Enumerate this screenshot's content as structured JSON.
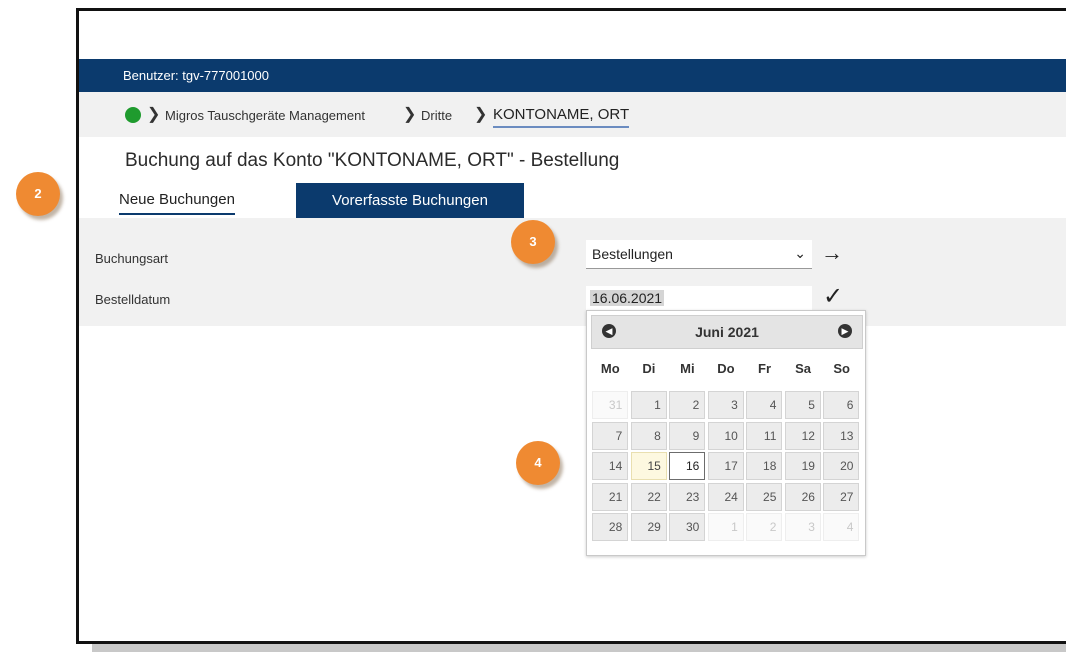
{
  "user_bar": {
    "label": "Benutzer: tgv-777001000"
  },
  "breadcrumb": {
    "items": [
      "Migros Tauschgeräte Management",
      "Dritte"
    ],
    "current": "KONTONAME, ORT"
  },
  "page_title": "Buchung auf das Konto \"KONTONAME, ORT\" - Bestellung",
  "tabs": {
    "new": "Neue Buchungen",
    "prepared": "Vorerfasste Buchungen"
  },
  "form": {
    "buchungsart_label": "Buchungsart",
    "buchungsart_value": "Bestellungen",
    "bestelldatum_label": "Bestelldatum",
    "bestelldatum_value": "16.06.2021"
  },
  "calendar": {
    "title": "Juni 2021",
    "weekdays": [
      "Mo",
      "Di",
      "Mi",
      "Do",
      "Fr",
      "Sa",
      "So"
    ],
    "weeks": [
      [
        "31",
        "1",
        "2",
        "3",
        "4",
        "5",
        "6"
      ],
      [
        "7",
        "8",
        "9",
        "10",
        "11",
        "12",
        "13"
      ],
      [
        "14",
        "15",
        "16",
        "17",
        "18",
        "19",
        "20"
      ],
      [
        "21",
        "22",
        "23",
        "24",
        "25",
        "26",
        "27"
      ],
      [
        "28",
        "29",
        "30",
        "1",
        "2",
        "3",
        "4"
      ]
    ],
    "today": "15",
    "selected": "16"
  },
  "badges": [
    "2",
    "3",
    "4"
  ],
  "colors": {
    "navy": "#0b3a6d",
    "badge_orange": "#ef8a32",
    "status_green": "#1f9b2e"
  }
}
